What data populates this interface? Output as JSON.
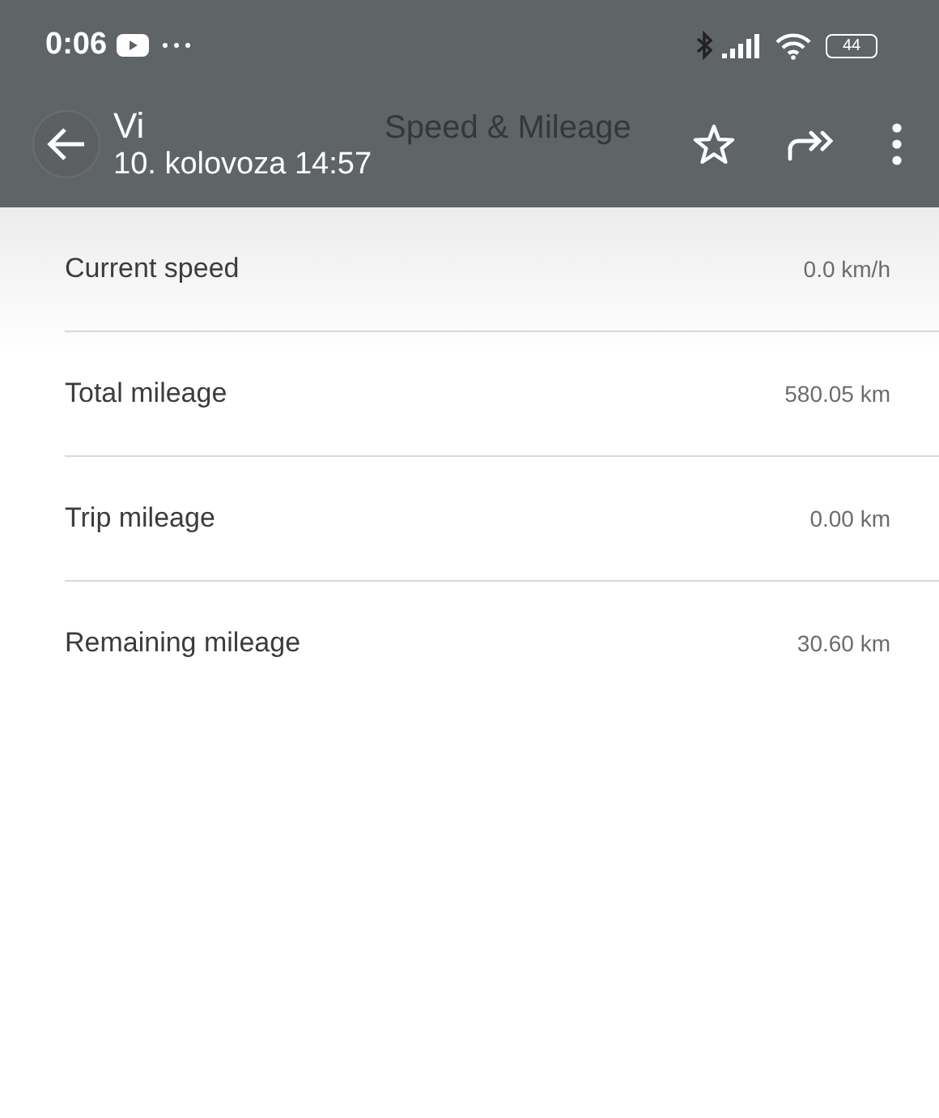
{
  "status_bar": {
    "time": "0:06",
    "battery": "44"
  },
  "viewer": {
    "sender": "Vi",
    "date": "10. kolovoza 14:57"
  },
  "app_bar": {
    "title": "Speed & Mileage"
  },
  "rows": [
    {
      "label": "Current speed",
      "value": "0.0 km/h"
    },
    {
      "label": "Total mileage",
      "value": "580.05 km"
    },
    {
      "label": "Trip mileage",
      "value": "0.00 km"
    },
    {
      "label": "Remaining mileage",
      "value": "30.60 km"
    }
  ]
}
